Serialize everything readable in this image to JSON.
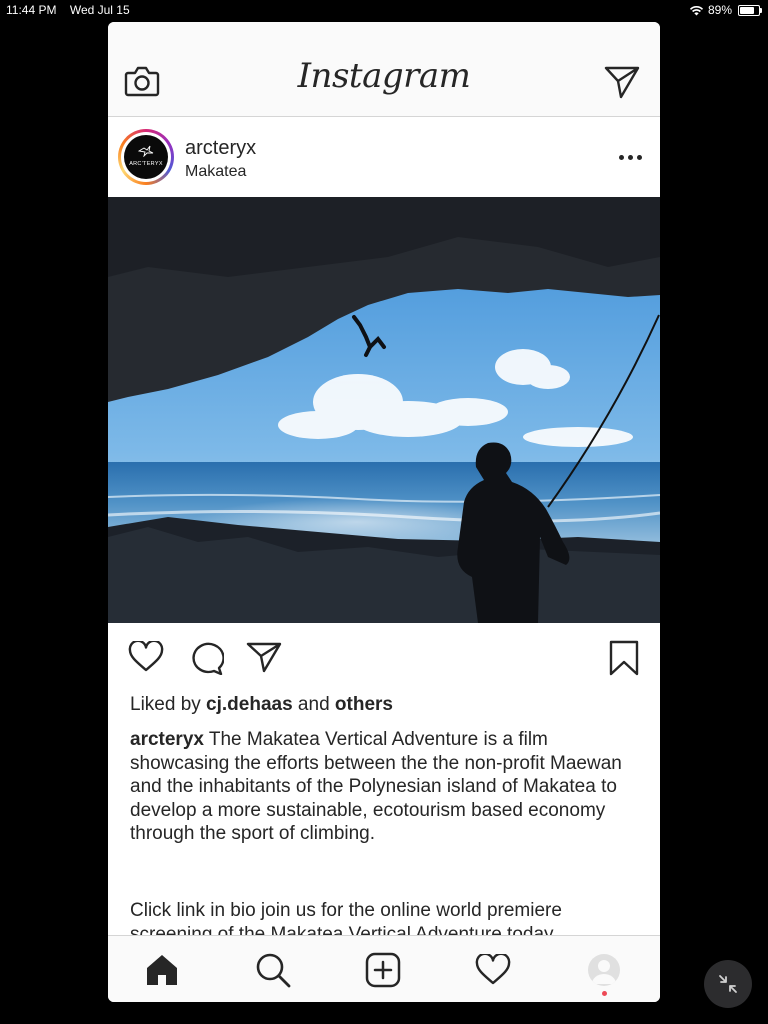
{
  "status_bar": {
    "time": "11:44 PM",
    "date": "Wed Jul 15",
    "battery": "89%",
    "battery_level": 0.89
  },
  "app": {
    "title": "Instagram"
  },
  "post": {
    "username": "arcteryx",
    "location": "Makatea",
    "avatar_text": "ARC'TERYX",
    "liked_by_prefix": "Liked by ",
    "liked_by_user": "cj.dehaas",
    "liked_by_and": " and ",
    "liked_by_others": "others",
    "caption_user": "arcteryx",
    "caption_text": " The Makatea Vertical Adventure is a film showcasing the efforts between the the non-profit Maewan and the inhabitants of the Polynesian island of Makatea to develop a more sustainable, ecotourism based economy through the sport of climbing.",
    "caption_more": "Click link in bio join us for the online world premiere screening of the Makatea Vertical Adventure today"
  },
  "icons": {
    "camera": "camera-icon",
    "direct": "paper-plane-icon",
    "more": "more-options-icon",
    "like": "heart-icon",
    "comment": "comment-icon",
    "share": "paper-plane-icon",
    "save": "bookmark-icon",
    "home": "home-icon",
    "search": "search-icon",
    "add": "add-post-icon",
    "activity": "heart-icon",
    "profile": "profile-icon",
    "exit": "exit-fullscreen-icon"
  },
  "colors": {
    "text": "#262626",
    "notification_dot": "#ed4956",
    "background": "#000000"
  }
}
